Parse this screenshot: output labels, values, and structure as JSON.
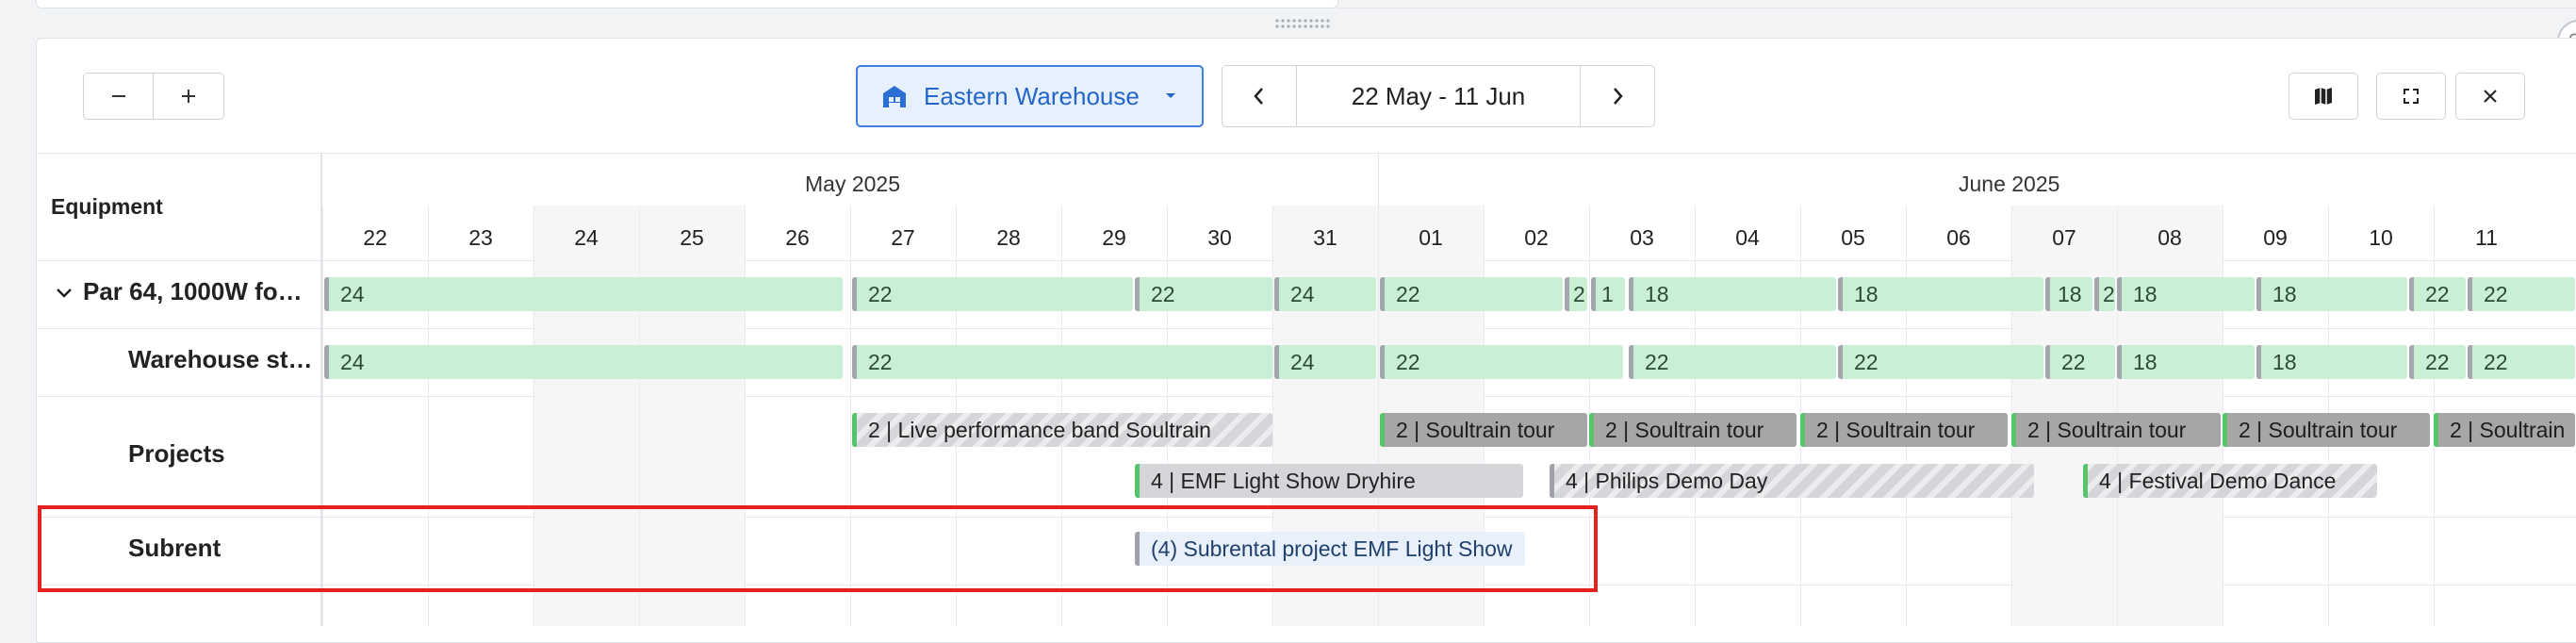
{
  "toolbar": {
    "zoom_out_icon": "minus-icon",
    "zoom_in_icon": "plus-icon",
    "warehouse": {
      "label": "Eastern Warehouse",
      "icon": "warehouse-icon"
    },
    "date_range": "22 May - 11 Jun",
    "right_icons": [
      "map-icon",
      "fullscreen-icon",
      "close-icon"
    ]
  },
  "grid": {
    "equipment_header": "Equipment",
    "months": [
      "May 2025",
      "June 2025"
    ],
    "days": [
      "22",
      "23",
      "24",
      "25",
      "26",
      "27",
      "28",
      "29",
      "30",
      "31",
      "01",
      "02",
      "03",
      "04",
      "05",
      "06",
      "07",
      "08",
      "09",
      "10",
      "11"
    ],
    "rows": {
      "item": "Par 64, 1000W fo…",
      "warehouse": "Warehouse st…",
      "projects": "Projects",
      "subrent": "Subrent"
    }
  },
  "availability_item": [
    "24",
    "22",
    "22",
    "24",
    "22",
    "2",
    "1",
    "18",
    "18",
    "18",
    "2",
    "18",
    "18",
    "22",
    "22"
  ],
  "availability_warehouse": [
    "24",
    "22",
    "24",
    "22",
    "22",
    "22",
    "22",
    "18",
    "18",
    "22",
    "22"
  ],
  "projects": [
    "2 | Live performance band Soultrain",
    "2 | Soultrain tour",
    "2 | Soultrain tour",
    "2 | Soultrain tour",
    "2 | Soultrain tour",
    "2 | Soultrain tour",
    "2 | Soultrain",
    "4 | EMF Light Show Dryhire",
    "4 | Philips Demo Day",
    "4 | Festival Demo Dance"
  ],
  "subrent": [
    "(4) Subrental project EMF Light Show"
  ]
}
